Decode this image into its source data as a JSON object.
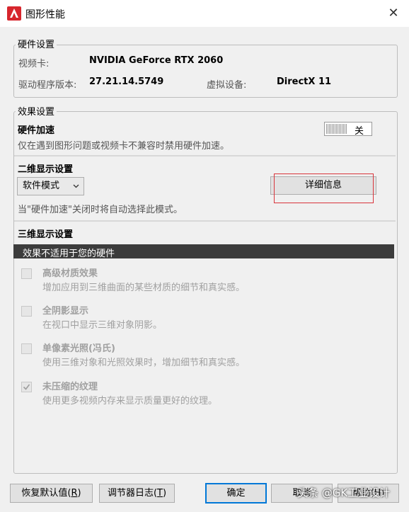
{
  "window": {
    "title": "图形性能",
    "app_icon": "autocad-a-icon",
    "close_glyph": "✕"
  },
  "hardware": {
    "group_label": "硬件设置",
    "video_card_label": "视频卡:",
    "video_card_value": "NVIDIA GeForce RTX 2060",
    "driver_label": "驱动程序版本:",
    "driver_value": "27.21.14.5749",
    "virtual_label": "虚拟设备:",
    "virtual_value": "DirectX 11"
  },
  "effects": {
    "group_label": "效果设置",
    "hw_accel_title": "硬件加速",
    "hw_accel_state": "关",
    "hw_accel_desc": "仅在遇到图形问题或视频卡不兼容时禁用硬件加速。",
    "display2d_title": "二维显示设置",
    "mode_select": "软件模式",
    "details_button": "详细信息",
    "mode_note": "当\"硬件加速\"关闭时将自动选择此模式。",
    "display3d_title": "三维显示设置",
    "unsupported_banner": "效果不适用于您的硬件",
    "options": [
      {
        "title": "高级材质效果",
        "desc": "增加应用到三维曲面的某些材质的细节和真实感。",
        "checked": false
      },
      {
        "title": "全阴影显示",
        "desc": "在视口中显示三维对象阴影。",
        "checked": false
      },
      {
        "title": "单像素光照(冯氏)",
        "desc": "使用三维对象和光照效果时，增加细节和真实感。",
        "checked": false
      },
      {
        "title": "未压缩的纹理",
        "desc": "使用更多视频内存来显示质量更好的纹理。",
        "checked": true
      }
    ]
  },
  "footer": {
    "restore_prefix": "恢复默认值(",
    "restore_key": "R",
    "restore_suffix": ")",
    "log_prefix": "调节器日志(",
    "log_key": "T",
    "log_suffix": ")",
    "ok": "确定",
    "cancel": "取消",
    "help": "帮助(H)",
    "watermark": "头条 @GK工业设计"
  },
  "colors": {
    "highlight_box": "#d9343b",
    "banner_bg": "#3c3c3c"
  }
}
